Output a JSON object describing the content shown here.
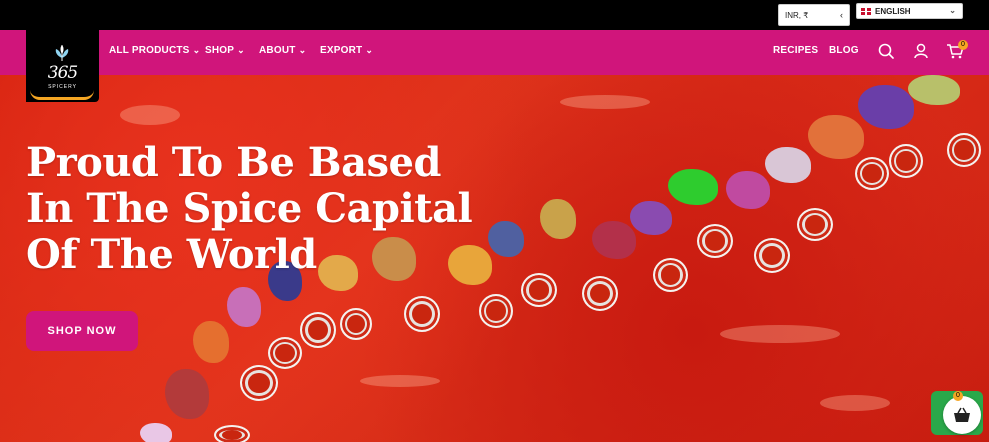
{
  "topbar": {
    "currency": "INR, ₹",
    "language": "ENGLISH"
  },
  "brand": {
    "number": "365",
    "name": "SPICERY"
  },
  "nav": {
    "items": [
      {
        "label": "ALL PRODUCTS",
        "has_dropdown": true
      },
      {
        "label": "SHOP",
        "has_dropdown": true
      },
      {
        "label": "ABOUT",
        "has_dropdown": true
      },
      {
        "label": "EXPORT",
        "has_dropdown": true
      }
    ],
    "right_links": [
      {
        "label": "RECIPES"
      },
      {
        "label": "BLOG"
      }
    ],
    "icons": [
      "search-icon",
      "user-icon",
      "cart-icon"
    ],
    "cart_count": "0"
  },
  "hero": {
    "headline_line1": "Proud To Be Based",
    "headline_line2": "In The Spice Capital",
    "headline_line3": "Of The World",
    "cta_label": "SHOP NOW"
  },
  "floating_cart": {
    "count": "0"
  },
  "colors": {
    "brand_pink": "#d0157b",
    "accent_orange": "#f5a623",
    "chili_red": "#d5220f",
    "float_green": "#2aa84a"
  }
}
